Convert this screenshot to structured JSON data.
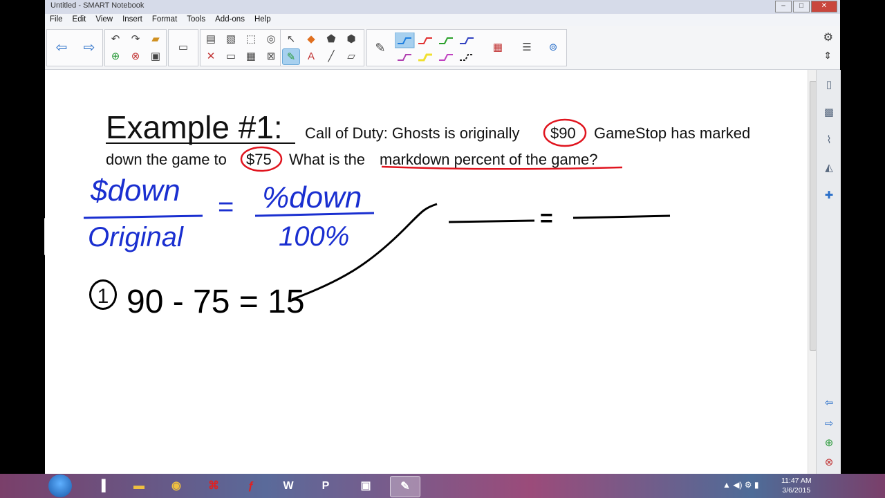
{
  "window": {
    "title": "Untitled - SMART Notebook",
    "controls": [
      "minimize",
      "maximize",
      "close"
    ]
  },
  "menu": [
    "File",
    "Edit",
    "View",
    "Insert",
    "Format",
    "Tools",
    "Add-ons",
    "Help"
  ],
  "toolbar": {
    "icons": [
      "back-icon",
      "forward-icon",
      "undo-icon",
      "redo-icon",
      "open-icon",
      "add-page-icon",
      "delete-page-icon",
      "save-icon",
      "screen-shade-icon",
      "paste-icon",
      "capture-icon",
      "full-screen-icon",
      "table-icon",
      "clear-icon",
      "cut-icon",
      "document-camera-icon",
      "select-icon",
      "magic-pen-icon",
      "shape-recognition-icon",
      "creative-pen-icon",
      "text-icon",
      "line-icon",
      "eraser-icon",
      "pen-icon",
      "fill-icon",
      "properties-icon",
      "link-icon"
    ],
    "pen_colors": [
      "#1f7fe0",
      "#e03030",
      "#2aa02a",
      "#3040c0",
      "#b040b0",
      "#f0e030",
      "#c040c0",
      "#222222"
    ],
    "active_tool": "creative-pen-icon"
  },
  "page": {
    "heading": "Example #1:",
    "line1": "Call of Duty: Ghosts is originally",
    "price_original": "$90",
    "line1_end": "GameStop has marked",
    "line2_start": "down the game to",
    "price_new": "$75",
    "question": "What is the",
    "question_underlined": "markdown percent of the game?",
    "handwriting": {
      "fraction_left_top": "$down",
      "fraction_left_bottom": "Original",
      "equals": "=",
      "fraction_right_top": "%down",
      "fraction_right_bottom": "100%",
      "step_number": "1",
      "step_text": "90 - 75 = 15",
      "blank_equals": "="
    },
    "ink_colors": {
      "blue": "#1a2fd0",
      "black": "#000000",
      "red": "#e0141e"
    }
  },
  "sidebar_tabs": [
    "page-sorter-icon",
    "gallery-icon",
    "attachments-icon",
    "properties-icon",
    "add-ons-icon"
  ],
  "sidebar_bottom": [
    "previous-page-icon",
    "next-page-icon",
    "add-page-icon",
    "delete-page-icon"
  ],
  "taskbar": {
    "apps": [
      "windows-explorer-icon",
      "file-folder-icon",
      "chrome-icon",
      "acrobat-icon",
      "flash-icon",
      "word-icon",
      "powerpoint-icon",
      "app-window-icon",
      "smart-notebook-icon"
    ],
    "clock_time": "11:47 AM",
    "clock_date": "3/6/2015"
  }
}
